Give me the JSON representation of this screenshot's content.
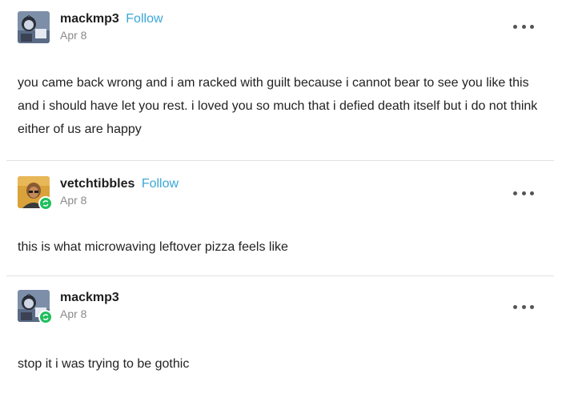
{
  "posts": [
    {
      "username": "mackmp3",
      "follow_label": "Follow",
      "date": "Apr 8",
      "more_icon": "ellipsis-horizontal-icon",
      "online": false,
      "text": "you came back wrong and i am racked with guilt because i cannot bear to see you like this and i should have let you rest. i loved you so much that i defied death itself but i do not think either of us are happy"
    },
    {
      "username": "vetchtibbles",
      "follow_label": "Follow",
      "date": "Apr 8",
      "more_icon": "ellipsis-horizontal-icon",
      "online": true,
      "text": "this is what microwaving leftover pizza feels like"
    },
    {
      "username": "mackmp3",
      "follow_label": "",
      "date": "Apr 8",
      "more_icon": "ellipsis-horizontal-icon",
      "online": true,
      "text": "stop it i was trying to be gothic"
    }
  ],
  "colors": {
    "follow": "#3aa7d8",
    "online_badge": "#1fbf5c",
    "divider": "#e2e2e2",
    "date": "#8a8a8a"
  }
}
